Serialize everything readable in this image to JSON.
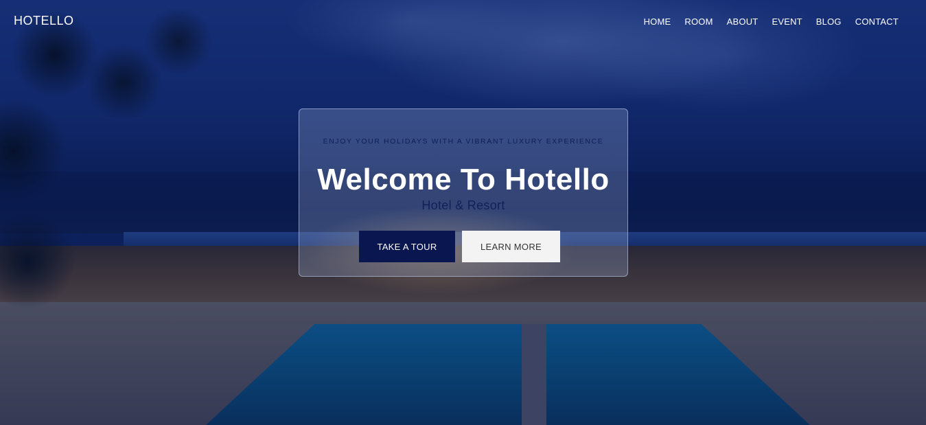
{
  "header": {
    "logo": "HOTELLO",
    "nav": [
      "HOME",
      "ROOM",
      "ABOUT",
      "EVENT",
      "BLOG",
      "CONTACT"
    ]
  },
  "hero": {
    "tagline": "ENJOY YOUR HOLIDAYS WITH A VIBRANT LUXURY EXPERIENCE",
    "title": "Welcome To Hotello",
    "subtitle": "Hotel & Resort",
    "primary_button": "TAKE A TOUR",
    "secondary_button": "LEARN MORE"
  },
  "colors": {
    "overlay": "#0a1950",
    "primary_button_bg": "#0a1650",
    "secondary_button_bg": "#f3f3f3",
    "subtitle": "#10205a"
  }
}
